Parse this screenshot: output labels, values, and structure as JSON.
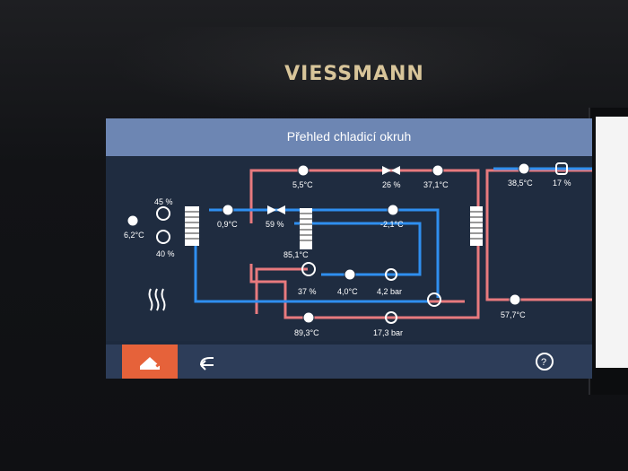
{
  "brand": "VIESSMANN",
  "screen": {
    "title": "Přehled chladicí okruh"
  },
  "readings": {
    "outdoor_temp": "6,2°C",
    "fan_top": "45 %",
    "fan_bottom": "40 %",
    "left_hx_temp": "0,9°C",
    "exp_valve_left": "59 %",
    "suction_temp": "5,5°C",
    "exp_valve_top": "26 %",
    "liquid_temp": "37,1°C",
    "flow_temp": "38,5°C",
    "pump_pct": "17 %",
    "mid_temp": "-2,1°C",
    "hx_temp": "85,1°C",
    "compressor_pct": "37 %",
    "evap_temp": "4,0°C",
    "low_pressure": "4,2 bar",
    "discharge_temp": "89,3°C",
    "high_pressure": "17,3 bar",
    "return_temp": "57,7°C"
  },
  "icons": {
    "home": "house-wrench-icon",
    "back": "back-arrow-icon",
    "help": "help-icon",
    "heating": "heating-waves-icon"
  },
  "colors": {
    "hot_line": "#e87a7e",
    "cold_line": "#2f8ff0",
    "accent": "#e6623a",
    "title_bar": "#6d86b3"
  }
}
